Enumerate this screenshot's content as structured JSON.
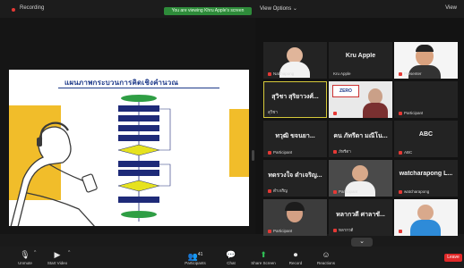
{
  "topbar": {
    "recording_label": "Recording",
    "share_banner": "You are viewing Khru Apple's screen",
    "view_options": "View Options ⌄",
    "right_label": "View"
  },
  "slide": {
    "title": "แผนภาพกระบวนการคิดเชิงคำนวณ"
  },
  "gallery": {
    "tiles": [
      {
        "big": "",
        "label": "Natthapong",
        "muted": true
      },
      {
        "big": "Kru Apple",
        "label": "Kru Apple",
        "muted": false
      },
      {
        "big": "",
        "label": "Presenter",
        "muted": true
      },
      {
        "big": "สุวิชา สุริยาวงศ์...",
        "label": "สุวิชา",
        "muted": false
      },
      {
        "big": "",
        "label": "ZERO",
        "muted": true
      },
      {
        "big": "",
        "label": "Participant",
        "muted": true
      },
      {
        "big": "ทวุฒิ ขจนยา...",
        "label": "Participant",
        "muted": true
      },
      {
        "big": "คน ภัทรีดา มณีโน...",
        "label": "ภัทรีดา",
        "muted": true
      },
      {
        "big": "ABC",
        "label": "ABC",
        "muted": true
      },
      {
        "big": "ทดรวงใจ ดำเจริญ...",
        "label": "ดำเจริญ",
        "muted": true
      },
      {
        "big": "",
        "label": "Participant",
        "muted": true
      },
      {
        "big": "watcharapong L...",
        "label": "watcharapong",
        "muted": true
      },
      {
        "big": "",
        "label": "Participant",
        "muted": true
      },
      {
        "big": "หลากวดี ศาลาชั...",
        "label": "หลากวดี",
        "muted": true
      },
      {
        "big": "",
        "label": "Participant",
        "muted": true
      }
    ],
    "more_label": "⌄"
  },
  "toolbar": {
    "unmute": "Unmute",
    "start_video": "Start Video",
    "participants": "Participants",
    "participants_count": "41",
    "chat": "Chat",
    "share_screen": "Share Screen",
    "record": "Record",
    "reactions": "Reactions",
    "leave": "Leave"
  },
  "colors": {
    "background": "#1a1a1a",
    "slide_yellow": "#f1bd2a",
    "flow_navy": "#1e2a78",
    "flow_yellow": "#e6e21f",
    "flow_green": "#2f9e44",
    "active_speaker": "#d6c93a",
    "leave_red": "#e02828"
  }
}
